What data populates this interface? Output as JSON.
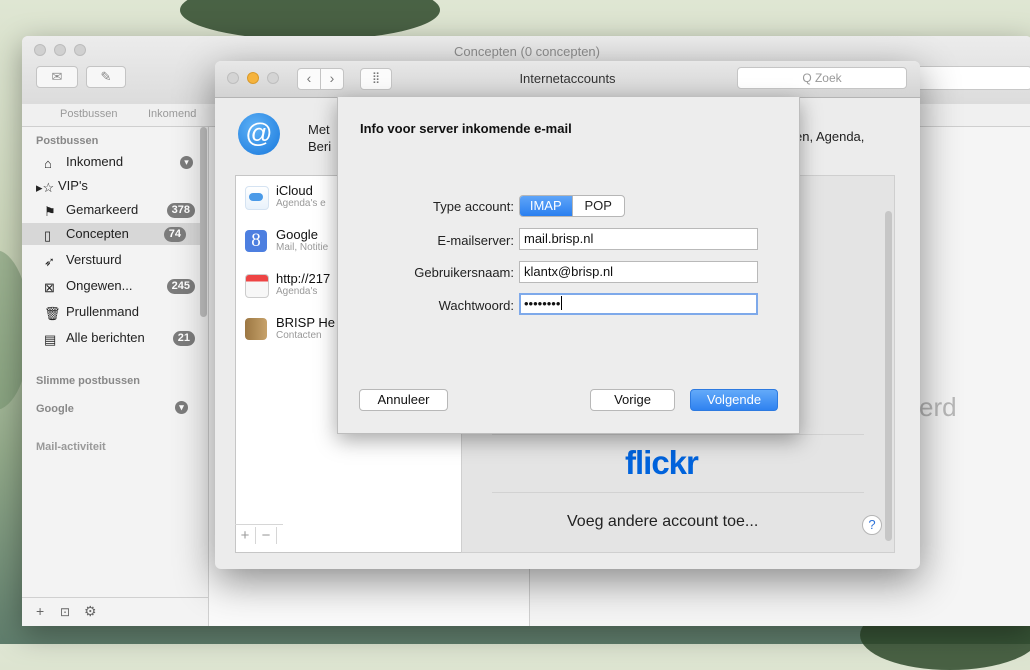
{
  "mail": {
    "window_title": "Concepten (0 concepten)",
    "favorites": {
      "mailboxes": "Postbussen",
      "inbox": "Inkomend"
    },
    "sidebar": {
      "section_mailboxes": "Postbussen",
      "items": [
        {
          "label": "Inkomend",
          "icon": "inbox-icon",
          "badge": ""
        },
        {
          "label": "VIP's",
          "icon": "star-icon",
          "badge": ""
        },
        {
          "label": "Gemarkeerd",
          "icon": "flag-icon",
          "badge": "378"
        },
        {
          "label": "Concepten",
          "icon": "draft-icon",
          "badge": "74"
        },
        {
          "label": "Verstuurd",
          "icon": "sent-icon",
          "badge": ""
        },
        {
          "label": "Ongewen...",
          "icon": "junk-icon",
          "badge": "245"
        },
        {
          "label": "Prullenmand",
          "icon": "trash-icon",
          "badge": ""
        },
        {
          "label": "Alle berichten",
          "icon": "archive-icon",
          "badge": "21"
        }
      ],
      "section_smart": "Slimme postbussen",
      "section_google": "Google",
      "section_activity": "Mail-activiteit"
    },
    "empty_label": "erd"
  },
  "accounts": {
    "window_title": "Internetaccounts",
    "search_placeholder": "Q Zoek",
    "intro_left": "Met\nBeri",
    "intro_right": "en, Agenda,",
    "list": [
      {
        "name": "iCloud",
        "sub": "Agenda's e"
      },
      {
        "name": "Google",
        "sub": "Mail, Notitie"
      },
      {
        "name": "http://217",
        "sub": "Agenda's"
      },
      {
        "name": "BRISP He",
        "sub": "Contacten"
      }
    ],
    "provider_logo": "flickr",
    "add_other": "Voeg andere account toe...",
    "help": "?"
  },
  "sheet": {
    "title": "Info voor server inkomende e-mail",
    "type_label": "Type account:",
    "type_options": [
      "IMAP",
      "POP"
    ],
    "type_selected": "IMAP",
    "server_label": "E-mailserver:",
    "server_value": "mail.brisp.nl",
    "user_label": "Gebruikersnaam:",
    "user_value": "klantx@brisp.nl",
    "password_label": "Wachtwoord:",
    "password_value": "••••••••",
    "cancel": "Annuleer",
    "back": "Vorige",
    "next": "Volgende"
  },
  "colors": {
    "accent": "#2a7ff0",
    "flickr": "#0063dc",
    "badge": "#7c7c7c"
  }
}
